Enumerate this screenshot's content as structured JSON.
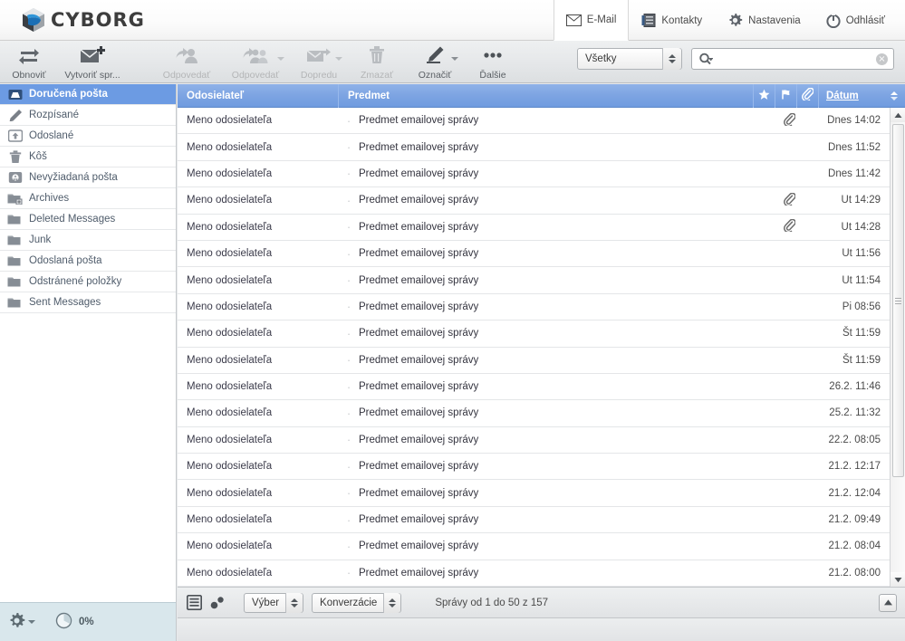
{
  "app": {
    "brand": "CYBORG"
  },
  "taskbar": {
    "items": [
      {
        "label": "E-Mail",
        "icon": "envelope-icon",
        "selected": true
      },
      {
        "label": "Kontakty",
        "icon": "address-book-icon",
        "selected": false
      },
      {
        "label": "Nastavenia",
        "icon": "gear-icon",
        "selected": false
      },
      {
        "label": "Odhlásiť",
        "icon": "power-icon",
        "selected": false
      }
    ]
  },
  "toolbar": {
    "buttons": [
      {
        "label": "Obnoviť",
        "icon": "refresh-icon",
        "disabled": false,
        "caret": false
      },
      {
        "label": "Vytvoriť spr...",
        "icon": "compose-icon",
        "disabled": false,
        "caret": false
      },
      {
        "label": "Odpovedať",
        "icon": "reply-icon",
        "disabled": true,
        "caret": false
      },
      {
        "label": "Odpovedať",
        "icon": "reply-all-icon",
        "disabled": true,
        "caret": true
      },
      {
        "label": "Dopredu",
        "icon": "forward-icon",
        "disabled": true,
        "caret": true
      },
      {
        "label": "Zmazať",
        "icon": "trash-icon",
        "disabled": true,
        "caret": false
      },
      {
        "label": "Označiť",
        "icon": "mark-pencil-icon",
        "disabled": false,
        "caret": true
      },
      {
        "label": "Ďalšie",
        "icon": "more-dots-icon",
        "disabled": false,
        "caret": false
      }
    ],
    "scope": {
      "value": "Všetky"
    },
    "search": {
      "value": "",
      "placeholder": ""
    }
  },
  "sidebar": {
    "folders": [
      {
        "label": "Doručená pošta",
        "icon": "inbox-icon",
        "active": true
      },
      {
        "label": "Rozpísané",
        "icon": "drafts-pencil-icon",
        "active": false
      },
      {
        "label": "Odoslané",
        "icon": "sent-icon",
        "active": false
      },
      {
        "label": "Kôš",
        "icon": "trash-icon",
        "active": false
      },
      {
        "label": "Nevyžiadaná pošta",
        "icon": "junk-icon",
        "active": false
      },
      {
        "label": "Archives",
        "icon": "folder-plus-icon",
        "active": false
      },
      {
        "label": "Deleted Messages",
        "icon": "folder-icon",
        "active": false
      },
      {
        "label": "Junk",
        "icon": "folder-icon",
        "active": false
      },
      {
        "label": "Odoslaná pošta",
        "icon": "folder-icon",
        "active": false
      },
      {
        "label": "Odstránené položky",
        "icon": "folder-icon",
        "active": false
      },
      {
        "label": "Sent Messages",
        "icon": "folder-icon",
        "active": false
      }
    ],
    "footer": {
      "settings_icon": "gear-icon",
      "quota_icon": "quota-pie-icon",
      "quota_text": "0%"
    }
  },
  "maillist": {
    "columns": {
      "sender": "Odosielateľ",
      "subject": "Predmet",
      "flag_star": "star-icon",
      "flag_unread": "flag-icon",
      "flag_attachment": "paperclip-icon",
      "date": "Dátum"
    },
    "sort_column": "Dátum",
    "rows": [
      {
        "sender": "Meno odosielateľa",
        "subject": "Predmet emailovej správy",
        "attachment": true,
        "date": "Dnes 14:02"
      },
      {
        "sender": "Meno odosielateľa",
        "subject": "Predmet emailovej správy",
        "attachment": false,
        "date": "Dnes 11:52"
      },
      {
        "sender": "Meno odosielateľa",
        "subject": "Predmet emailovej správy",
        "attachment": false,
        "date": "Dnes 11:42"
      },
      {
        "sender": "Meno odosielateľa",
        "subject": "Predmet emailovej správy",
        "attachment": true,
        "date": "Ut 14:29"
      },
      {
        "sender": "Meno odosielateľa",
        "subject": "Predmet emailovej správy",
        "attachment": true,
        "date": "Ut 14:28"
      },
      {
        "sender": "Meno odosielateľa",
        "subject": "Predmet emailovej správy",
        "attachment": false,
        "date": "Ut 11:56"
      },
      {
        "sender": "Meno odosielateľa",
        "subject": "Predmet emailovej správy",
        "attachment": false,
        "date": "Ut 11:54"
      },
      {
        "sender": "Meno odosielateľa",
        "subject": "Predmet emailovej správy",
        "attachment": false,
        "date": "Pi 08:56"
      },
      {
        "sender": "Meno odosielateľa",
        "subject": "Predmet emailovej správy",
        "attachment": false,
        "date": "Št 11:59"
      },
      {
        "sender": "Meno odosielateľa",
        "subject": "Predmet emailovej správy",
        "attachment": false,
        "date": "Št 11:59"
      },
      {
        "sender": "Meno odosielateľa",
        "subject": "Predmet emailovej správy",
        "attachment": false,
        "date": "26.2. 11:46"
      },
      {
        "sender": "Meno odosielateľa",
        "subject": "Predmet emailovej správy",
        "attachment": false,
        "date": "25.2. 11:32"
      },
      {
        "sender": "Meno odosielateľa",
        "subject": "Predmet emailovej správy",
        "attachment": false,
        "date": "22.2. 08:05"
      },
      {
        "sender": "Meno odosielateľa",
        "subject": "Predmet emailovej správy",
        "attachment": false,
        "date": "21.2. 12:17"
      },
      {
        "sender": "Meno odosielateľa",
        "subject": "Predmet emailovej správy",
        "attachment": false,
        "date": "21.2. 12:04"
      },
      {
        "sender": "Meno odosielateľa",
        "subject": "Predmet emailovej správy",
        "attachment": false,
        "date": "21.2. 09:49"
      },
      {
        "sender": "Meno odosielateľa",
        "subject": "Predmet emailovej správy",
        "attachment": false,
        "date": "21.2. 08:04"
      },
      {
        "sender": "Meno odosielateľa",
        "subject": "Predmet emailovej správy",
        "attachment": false,
        "date": "21.2. 08:00"
      }
    ]
  },
  "listfooter": {
    "list_mode_icon": "list-view-icon",
    "threads_icon": "threads-icon",
    "select_dropdown": "Výber",
    "mode_dropdown": "Konverzácie",
    "status": "Správy od 1 do 50 z 157",
    "expand_icon": "collapse-up-icon"
  },
  "colors": {
    "accent_blue": "#6c9be3",
    "header_blue": "#7da4e2",
    "sidebar_footer": "#d9e7ec",
    "toolbar_bg": "#e6e8ea"
  }
}
